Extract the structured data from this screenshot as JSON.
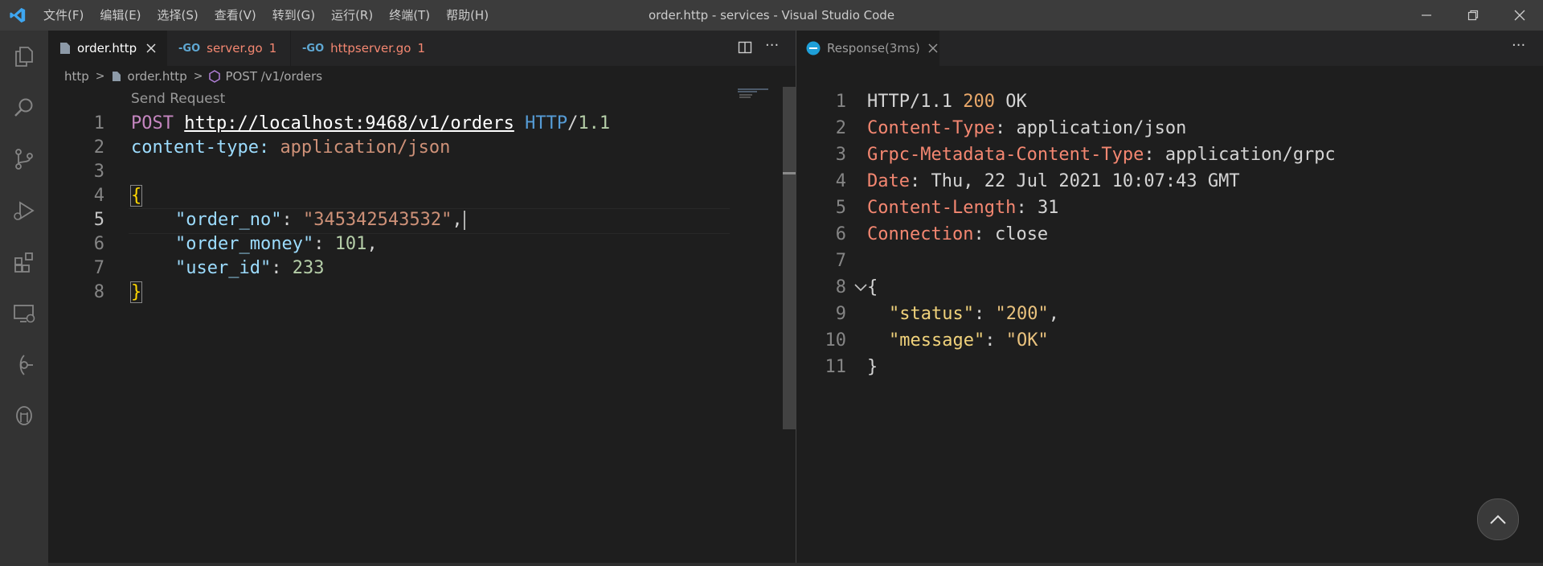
{
  "window": {
    "title": "order.http - services - Visual Studio Code"
  },
  "menu": [
    "文件(F)",
    "编辑(E)",
    "选择(S)",
    "查看(V)",
    "转到(G)",
    "运行(R)",
    "终端(T)",
    "帮助(H)"
  ],
  "activity_bar": [
    "explorer-icon",
    "search-icon",
    "source-control-icon",
    "run-debug-icon",
    "extensions-icon",
    "remote-explorer-icon",
    "gitlens-icon",
    "database-icon"
  ],
  "tabs": [
    {
      "label": "order.http",
      "icon": "http-file-icon"
    },
    {
      "label": "server.go",
      "badge": "1",
      "icon": "go-file-icon"
    },
    {
      "label": "httpserver.go",
      "badge": "1",
      "icon": "go-file-icon"
    }
  ],
  "response_tab": {
    "label": "Response(3ms)",
    "icon": "rest-client-icon"
  },
  "breadcrumb": {
    "folder": "http",
    "file": "order.http",
    "symbol": "POST /v1/orders"
  },
  "codelens": "Send Request",
  "editor": {
    "line_numbers": [
      "1",
      "2",
      "3",
      "4",
      "5",
      "6",
      "7",
      "8"
    ],
    "active_line": "5",
    "lines": {
      "l1": {
        "method": "POST",
        "url": "http://localhost:9468/v1/orders",
        "proto": "HTTP",
        "slash": "/",
        "ver": "1.1"
      },
      "l2": {
        "key": "content-type:",
        "value": "application/json"
      },
      "l4": {
        "brace": "{"
      },
      "l5": {
        "key": "\"order_no\"",
        "colon": ": ",
        "value": "\"345342543532\"",
        "comma": ","
      },
      "l6": {
        "key": "\"order_money\"",
        "colon": ": ",
        "value": "101",
        "comma": ","
      },
      "l7": {
        "key": "\"user_id\"",
        "colon": ": ",
        "value": "233"
      },
      "l8": {
        "brace": "}"
      }
    }
  },
  "response": {
    "line_numbers": [
      "1",
      "2",
      "3",
      "4",
      "5",
      "6",
      "7",
      "8",
      "9",
      "10",
      "11"
    ],
    "status_line": {
      "proto": "HTTP/1.1",
      "code": "200",
      "text": "OK"
    },
    "headers": [
      {
        "name": "Content-Type",
        "value": "application/json"
      },
      {
        "name": "Grpc-Metadata-Content-Type",
        "value": "application/grpc"
      },
      {
        "name": "Date",
        "value": "Thu, 22 Jul 2021 10:07:43 GMT"
      },
      {
        "name": "Content-Length",
        "value": "31"
      },
      {
        "name": "Connection",
        "value": "close"
      }
    ],
    "body": {
      "open": "{",
      "k1": "\"status\"",
      "v1": "\"200\"",
      "k2": "\"message\"",
      "v2": "\"OK\"",
      "close": "}"
    }
  },
  "colors": {
    "accent": "#007acc",
    "background": "#1e1e1e",
    "tab_bar": "#252526",
    "activity_bar": "#333333",
    "title_bar": "#3c3c3c"
  }
}
